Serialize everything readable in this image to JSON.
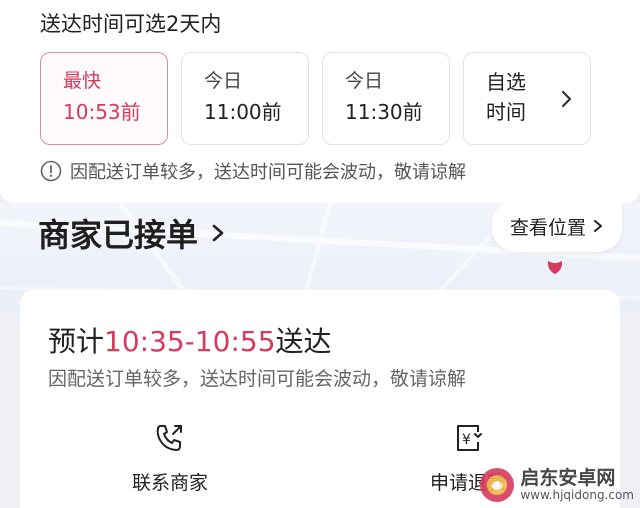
{
  "delivery": {
    "title": "送达时间可选2天内",
    "slots": [
      {
        "line1": "最快",
        "line2": "10:53前",
        "selected": true
      },
      {
        "line1": "今日",
        "line2": "11:00前",
        "selected": false
      },
      {
        "line1": "今日",
        "line2": "11:30前",
        "selected": false
      },
      {
        "line1": "自选",
        "line2": "时间",
        "selected": false
      }
    ],
    "notice": "因配送订单较多，送达时间可能会波动，敬请谅解"
  },
  "merchant": {
    "status_title": "商家已接单",
    "view_location": "查看位置"
  },
  "order": {
    "eta_prefix": "预计",
    "eta_range": "10:35-10:55",
    "eta_suffix": "送达",
    "eta_note": "因配送订单较多，送达时间可能会波动，敬请谅解",
    "actions": {
      "contact": "联系商家",
      "refund": "申请退款"
    }
  },
  "watermark": {
    "name": "启东安卓网",
    "url": "www.hjqidong.com"
  },
  "colors": {
    "accent": "#d63a5e",
    "text": "#222222",
    "muted": "#666666"
  }
}
